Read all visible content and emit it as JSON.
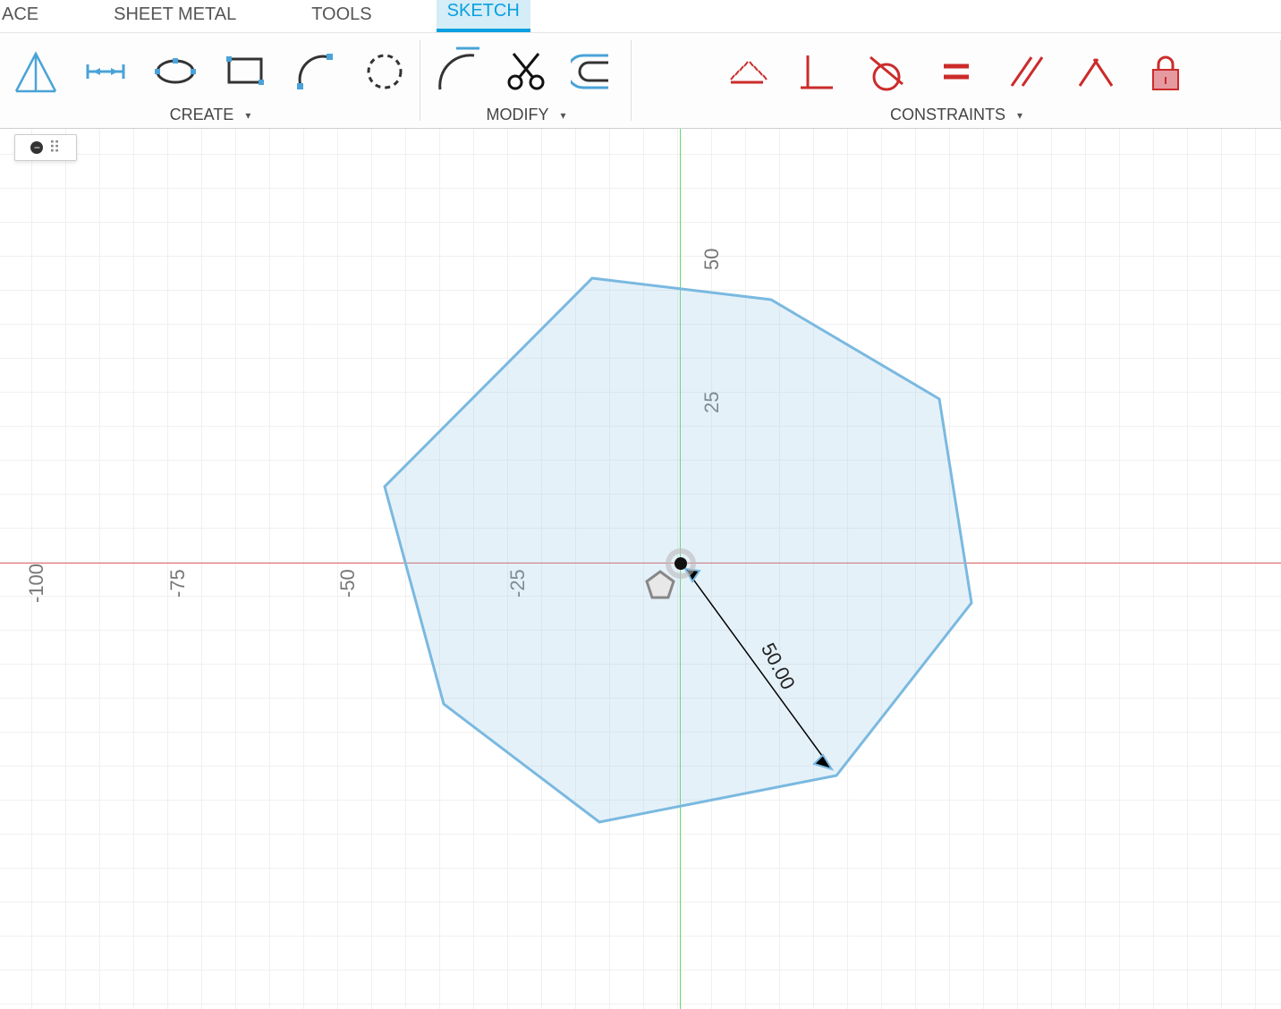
{
  "tabs": {
    "ace": "ACE",
    "sheet_metal": "SHEET METAL",
    "tools": "TOOLS",
    "sketch": "SKETCH"
  },
  "toolbar": {
    "create_label": "CREATE",
    "modify_label": "MODIFY",
    "constraints_label": "CONSTRAINTS"
  },
  "canvas": {
    "ticks_x": {
      "m100": "-100",
      "m75": "-75",
      "m50": "-50",
      "m25": "-25"
    },
    "ticks_y": {
      "p25": "25",
      "p50": "50"
    },
    "dimension": "50.00"
  },
  "colors": {
    "sketch_stroke": "#7ab9e0",
    "sketch_fill": "rgba(150,200,230,0.25)",
    "axis_x": "#d22",
    "axis_y": "#2c2",
    "constraint": "#cc2b2b",
    "active_tab": "#0aa0e0"
  }
}
